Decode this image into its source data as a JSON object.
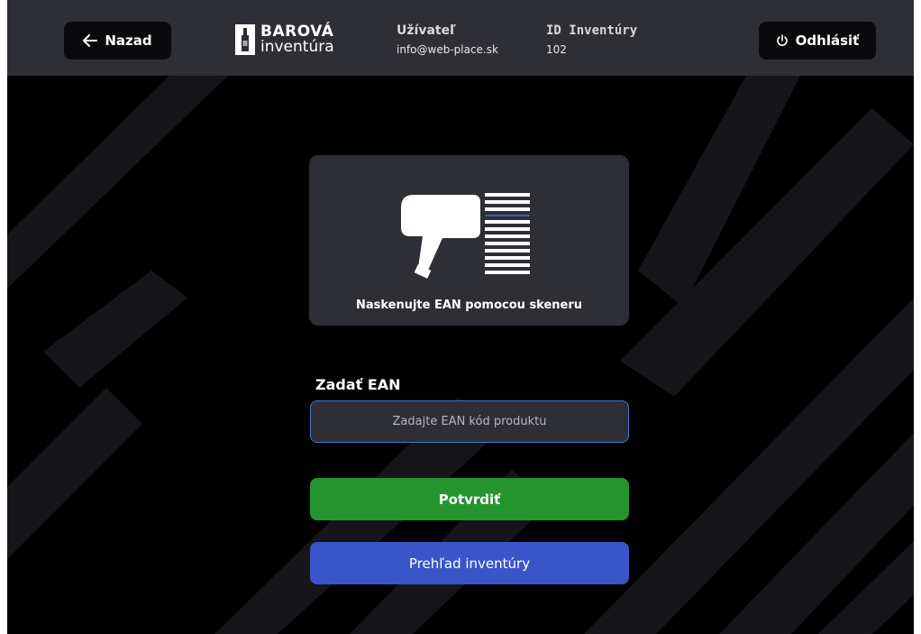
{
  "header": {
    "back_label": "Nazad",
    "logo_line1": "BAROVÁ",
    "logo_line2": "inventúra",
    "user_label": "Užívateľ",
    "user_email": "info@web-place.sk",
    "inventory_label": "ID Inventúry",
    "inventory_id": "102",
    "logout_label": "Odhlásiť"
  },
  "scanner": {
    "caption": "Naskenujte EAN pomocou skeneru"
  },
  "ean": {
    "label": "Zadať EAN",
    "placeholder": "Zadajte EAN kód produktu",
    "value": ""
  },
  "actions": {
    "confirm_label": "Potvrdiť",
    "overview_label": "Prehľad inventúry"
  },
  "colors": {
    "background": "#000000",
    "header": "#2e2e35",
    "confirm": "#24942e",
    "overview": "#3a55c8",
    "input_border": "#3c78d8"
  },
  "icons": {
    "back": "arrow-left-icon",
    "logout": "power-icon",
    "scanner": "barcode-scanner-icon",
    "logo": "bottle-icon"
  }
}
